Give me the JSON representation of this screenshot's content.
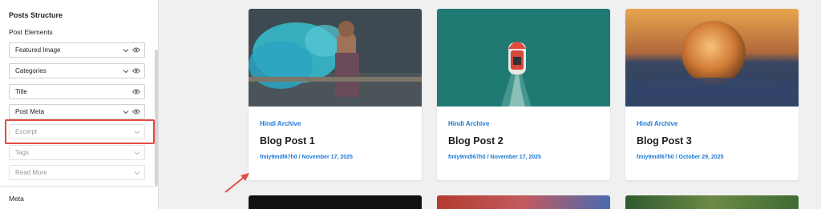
{
  "sidebar": {
    "section_title": "Posts Structure",
    "sub_title": "Post Elements",
    "elements": [
      {
        "label": "Featured Image",
        "has_chevron": true,
        "has_eye": true,
        "enabled": true
      },
      {
        "label": "Categories",
        "has_chevron": true,
        "has_eye": true,
        "enabled": true
      },
      {
        "label": "Title",
        "has_chevron": false,
        "has_eye": true,
        "enabled": true
      },
      {
        "label": "Post Meta",
        "has_chevron": true,
        "has_eye": true,
        "enabled": true
      },
      {
        "label": "Excerpt",
        "has_chevron": true,
        "has_eye": false,
        "enabled": false
      },
      {
        "label": "Tags",
        "has_chevron": true,
        "has_eye": false,
        "enabled": false
      },
      {
        "label": "Read More",
        "has_chevron": true,
        "has_eye": false,
        "enabled": false
      }
    ],
    "meta_title": "Meta"
  },
  "posts": [
    {
      "category": "Hindi Archive",
      "title": "Blog Post 1",
      "meta": "fmiy9mdl67h0 / November 17, 2025"
    },
    {
      "category": "Hindi Archive",
      "title": "Blog Post 2",
      "meta": "fmiy9mdl67h0 / November 17, 2025"
    },
    {
      "category": "Hindi Archive",
      "title": "Blog Post 3",
      "meta": "fmiy9mdl67h0 / October 29, 2025"
    }
  ],
  "colors": {
    "accent": "#1a7ad4",
    "highlight": "#e34b43"
  },
  "icons": {
    "chevron": "chevron-down-icon",
    "eye": "eye-icon",
    "arrow": "arrow-annotation-icon"
  }
}
